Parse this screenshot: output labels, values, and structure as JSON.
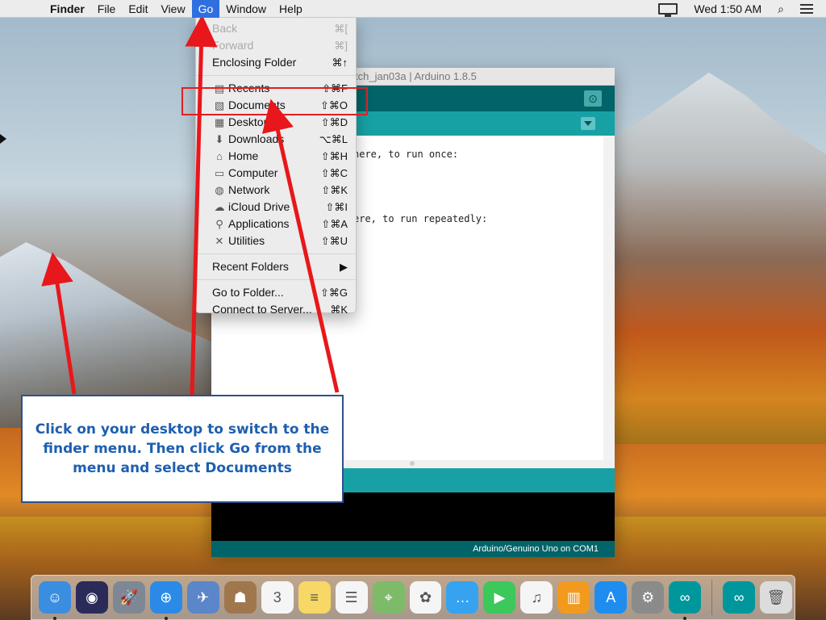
{
  "menubar": {
    "app_name": "Finder",
    "items": [
      "File",
      "Edit",
      "View",
      "Go",
      "Window",
      "Help"
    ],
    "active_item": "Go",
    "clock": "Wed 1:50 AM"
  },
  "go_menu": {
    "nav": [
      {
        "label": "Back",
        "shortcut": "⌘[",
        "disabled": true
      },
      {
        "label": "Forward",
        "shortcut": "⌘]",
        "disabled": true
      },
      {
        "label": "Enclosing Folder",
        "shortcut": "⌘↑",
        "disabled": false
      }
    ],
    "places": [
      {
        "label": "Recents",
        "shortcut": "⇧⌘F",
        "icon": "recents-icon"
      },
      {
        "label": "Documents",
        "shortcut": "⇧⌘O",
        "icon": "documents-icon"
      },
      {
        "label": "Desktop",
        "shortcut": "⇧⌘D",
        "icon": "desktop-icon"
      },
      {
        "label": "Downloads",
        "shortcut": "⌥⌘L",
        "icon": "downloads-icon"
      },
      {
        "label": "Home",
        "shortcut": "⇧⌘H",
        "icon": "home-icon"
      },
      {
        "label": "Computer",
        "shortcut": "⇧⌘C",
        "icon": "computer-icon"
      },
      {
        "label": "Network",
        "shortcut": "⇧⌘K",
        "icon": "network-icon"
      },
      {
        "label": "iCloud Drive",
        "shortcut": "⇧⌘I",
        "icon": "icloud-icon"
      },
      {
        "label": "Applications",
        "shortcut": "⇧⌘A",
        "icon": "applications-icon"
      },
      {
        "label": "Utilities",
        "shortcut": "⇧⌘U",
        "icon": "utilities-icon"
      }
    ],
    "recent_folders": {
      "label": "Recent Folders",
      "shortcut": "▶"
    },
    "bottom": [
      {
        "label": "Go to Folder...",
        "shortcut": "⇧⌘G"
      },
      {
        "label": "Connect to Server...",
        "shortcut": "⌘K"
      }
    ]
  },
  "arduino": {
    "window_title": "tch_jan03a | Arduino 1.8.5",
    "tab_label": "/",
    "code_lines": [
      "here, to run once:",
      "ere, to run repeatedly:"
    ],
    "board_status": "Arduino/Genuino Uno on COM1",
    "toolbar_color": "#006468",
    "tabs_color": "#17a1a5"
  },
  "annotation": {
    "text": "Click on your desktop to switch to the finder menu. Then click Go  from the menu and select Documents",
    "arrow_color": "#e8171b",
    "text_color": "#1e5fb0"
  },
  "dock": {
    "apps": [
      {
        "name": "finder",
        "color": "#3b8de0",
        "glyph": "☺",
        "running": true
      },
      {
        "name": "siri",
        "color": "#2b2b5a",
        "glyph": "◉",
        "running": false
      },
      {
        "name": "launchpad",
        "color": "#7d8894",
        "glyph": "🚀",
        "running": false
      },
      {
        "name": "safari",
        "color": "#2a8ae6",
        "glyph": "⊕",
        "running": true
      },
      {
        "name": "preview",
        "color": "#5b86c9",
        "glyph": "✈",
        "running": false
      },
      {
        "name": "contacts",
        "color": "#a0774c",
        "glyph": "☗",
        "running": false
      },
      {
        "name": "calendar",
        "color": "#f5f5f5",
        "glyph": "3",
        "running": false
      },
      {
        "name": "notes",
        "color": "#f7d765",
        "glyph": "≡",
        "running": false
      },
      {
        "name": "reminders",
        "color": "#f5f5f5",
        "glyph": "☰",
        "running": false
      },
      {
        "name": "maps",
        "color": "#7dbb68",
        "glyph": "⌖",
        "running": false
      },
      {
        "name": "photos",
        "color": "#f5f5f5",
        "glyph": "✿",
        "running": false
      },
      {
        "name": "messages",
        "color": "#36a3f0",
        "glyph": "…",
        "running": false
      },
      {
        "name": "facetime",
        "color": "#3cc85a",
        "glyph": "▶",
        "running": false
      },
      {
        "name": "itunes",
        "color": "#f5f5f5",
        "glyph": "♫",
        "running": false
      },
      {
        "name": "ibooks",
        "color": "#f29a1d",
        "glyph": "▥",
        "running": false
      },
      {
        "name": "app-store",
        "color": "#1f8cf0",
        "glyph": "A",
        "running": false
      },
      {
        "name": "system-preferences",
        "color": "#8b8b8b",
        "glyph": "⚙",
        "running": false
      },
      {
        "name": "arduino",
        "color": "#00979c",
        "glyph": "∞",
        "running": true
      }
    ],
    "after_separator": [
      {
        "name": "arduino-document",
        "color": "#00979c",
        "glyph": "∞"
      },
      {
        "name": "trash",
        "color": "#dcdcdc",
        "glyph": "🗑"
      }
    ]
  }
}
